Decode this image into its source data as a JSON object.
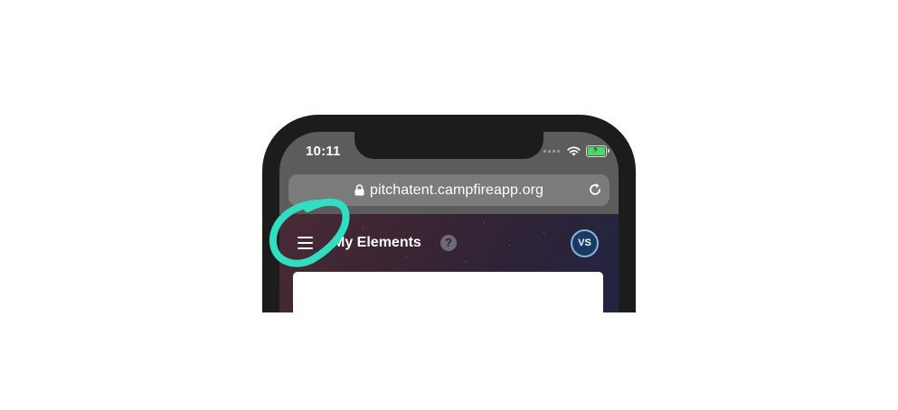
{
  "status_bar": {
    "time": "10:11",
    "signal_icon": "signal-dots-icon",
    "wifi_icon": "wifi-icon",
    "battery_icon": "battery-charging-icon",
    "battery_color": "#4cd964"
  },
  "browser": {
    "url": "pitchatent.campfireapp.org",
    "lock_icon": "lock-icon",
    "reload_icon": "reload-icon"
  },
  "app_header": {
    "menu_icon": "hamburger-menu-icon",
    "title": "My Elements",
    "help_label": "?",
    "avatar_initials": "VS"
  },
  "annotation": {
    "highlight_color": "#2de0c0",
    "target": "hamburger-menu-icon"
  }
}
